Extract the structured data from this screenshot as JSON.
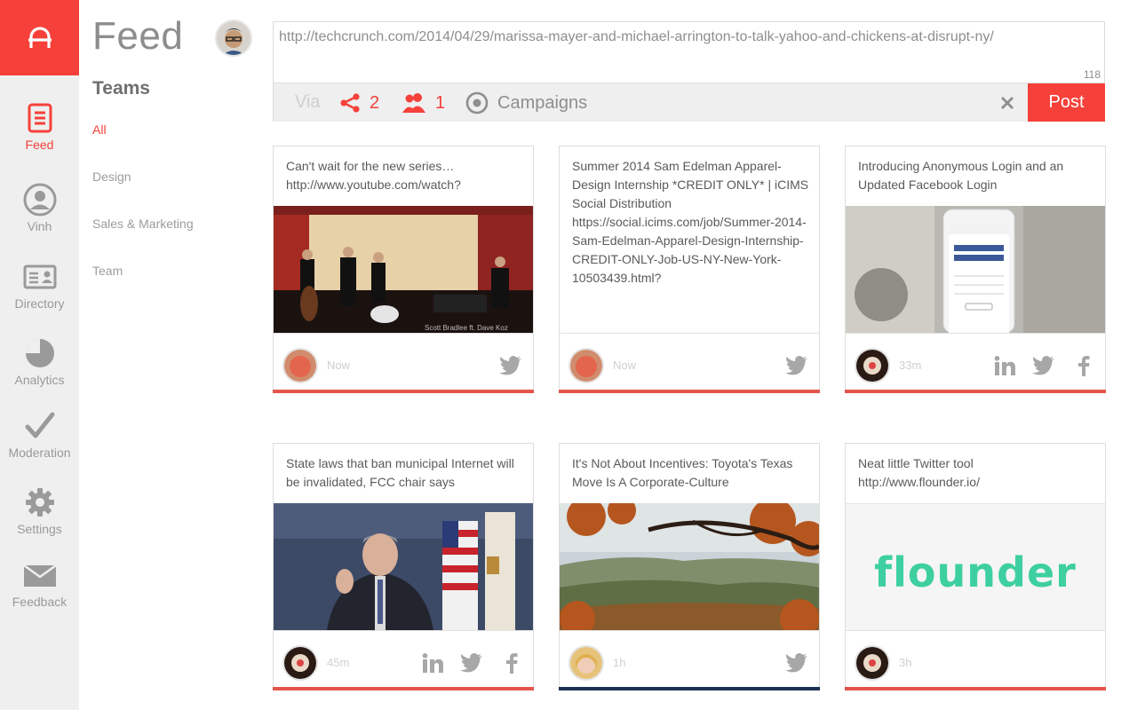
{
  "sidebar": {
    "items": [
      {
        "label": "Feed",
        "icon": "feed-icon",
        "active": true
      },
      {
        "label": "Vinh",
        "icon": "user-icon"
      },
      {
        "label": "Directory",
        "icon": "directory-icon"
      },
      {
        "label": "Analytics",
        "icon": "pie-chart-icon"
      },
      {
        "label": "Moderation",
        "icon": "checkmark-icon"
      },
      {
        "label": "Settings",
        "icon": "gear-icon"
      },
      {
        "label": "Feedback",
        "icon": "envelope-icon"
      }
    ]
  },
  "page": {
    "title": "Feed",
    "teams_heading": "Teams",
    "teams": [
      "All",
      "Design",
      "Sales & Marketing",
      "Team"
    ]
  },
  "composer": {
    "text": "http://techcrunch.com/2014/04/29/marissa-mayer-and-michael-arrington-to-talk-yahoo-and-chickens-at-disrupt-ny/",
    "char_count": "118",
    "via_label": "Via",
    "share_count": "2",
    "people_count": "1",
    "campaigns_label": "Campaigns",
    "post_label": "Post"
  },
  "cards": [
    {
      "caption": "Can't wait for the new series…http://www.youtube.com/watch?",
      "time": "Now",
      "networks": [
        "twitter"
      ]
    },
    {
      "caption": "Summer 2014 Sam Edelman Apparel-Design Internship *CREDIT ONLY* | iCIMS Social Distribution https://social.icims.com/job/Summer-2014-Sam-Edelman-Apparel-Design-Internship-CREDIT-ONLY-Job-US-NY-New-York-10503439.html?",
      "time": "Now",
      "networks": [
        "twitter"
      ]
    },
    {
      "caption": "Introducing Anonymous Login and an Updated Facebook Login",
      "time": "33m",
      "networks": [
        "linkedin",
        "twitter",
        "facebook"
      ]
    },
    {
      "caption": "State laws that ban municipal Internet will be invalidated, FCC chair says",
      "time": "45m",
      "networks": [
        "linkedin",
        "twitter",
        "facebook"
      ]
    },
    {
      "caption": "It's Not About Incentives: Toyota's Texas Move Is A Corporate-Culture",
      "time": "1h",
      "networks": [
        "twitter"
      ]
    },
    {
      "caption": "Neat little Twitter tool http://www.flounder.io/",
      "time": "3h",
      "networks": [],
      "logo_text": "flounder"
    }
  ],
  "colors": {
    "accent": "#f5413a",
    "rail_bg": "#efefef",
    "flounder_green": "#3ecfa0",
    "navy_line": "#1c3152"
  }
}
